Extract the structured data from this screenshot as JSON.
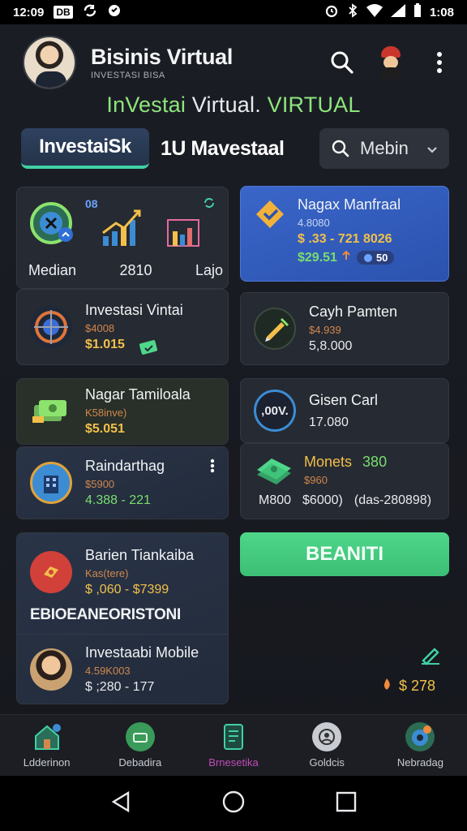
{
  "status_bar": {
    "time_left": "12:09",
    "box_label": "DB",
    "time_right": "1:08"
  },
  "header": {
    "title": "Bisinis Virtual",
    "subtitle": "INVESTASI BISA",
    "banner_left": "InVestai",
    "banner_mid": "Virtual.",
    "banner_right": "VIRTUAL"
  },
  "tabs": {
    "active": "InvestaiSk",
    "second": "1U Mavestaal",
    "filter_label": "Mebin"
  },
  "cards": {
    "stat_trio": {
      "corner_a": "08",
      "labels": [
        "Median",
        "2810",
        "Lajo"
      ]
    },
    "top_right": {
      "title": "Nagax Manfraal",
      "sub": "4.8080",
      "value": "$ .33 - 721 8026",
      "value2": "$29.51",
      "pill": "50"
    },
    "investasi_vintai": {
      "title": "Investasi Vintai",
      "sub": "$4008",
      "value": "$1.015"
    },
    "cash_pamten": {
      "title": "Cayh Pamten",
      "sub": "$4.939",
      "value": "5,8.000"
    },
    "nagar_tamiloala": {
      "title": "Nagar Tamiloala",
      "sub": "K58inve)",
      "value": "$5.051"
    },
    "gisen_carl": {
      "title": "Gisen Carl",
      "icon_text": ",00V.",
      "value": "17.080"
    },
    "raindarthag": {
      "title": "Raindarthag",
      "sub": "$5900",
      "value": "4.388 - 221"
    },
    "monets": {
      "title": "Monets",
      "title_value": "380",
      "sub": "$960",
      "row_left": "M800",
      "row_mid": "$6000)",
      "row_right": "(das-280898)"
    },
    "barien": {
      "title": "Barien Tiankaiba",
      "sub": "Kas(tere)",
      "value": "$ ,060 - $7399"
    },
    "section_label": "EBIOEANEORISTONI",
    "investaabi_mobile": {
      "title": "Investaabi Mobile",
      "sub": "4.59K003",
      "value": "$ ;280 - 177"
    },
    "floating_value": "$ 278"
  },
  "cta_label": "BEANITI",
  "bottom_nav": [
    {
      "label": "Ldderinon",
      "icon": "home-icon"
    },
    {
      "label": "Debadira",
      "icon": "briefcase-icon"
    },
    {
      "label": "Brnesetika",
      "icon": "document-icon"
    },
    {
      "label": "Goldcis",
      "icon": "person-icon"
    },
    {
      "label": "Nebradag",
      "icon": "globe-icon"
    }
  ],
  "colors": {
    "accent_green": "#41d0a5",
    "cta_green": "#4fd68a",
    "active_nav": "#c34bb8",
    "card_blue": "#3a66c9",
    "gold": "#f2c04a"
  }
}
